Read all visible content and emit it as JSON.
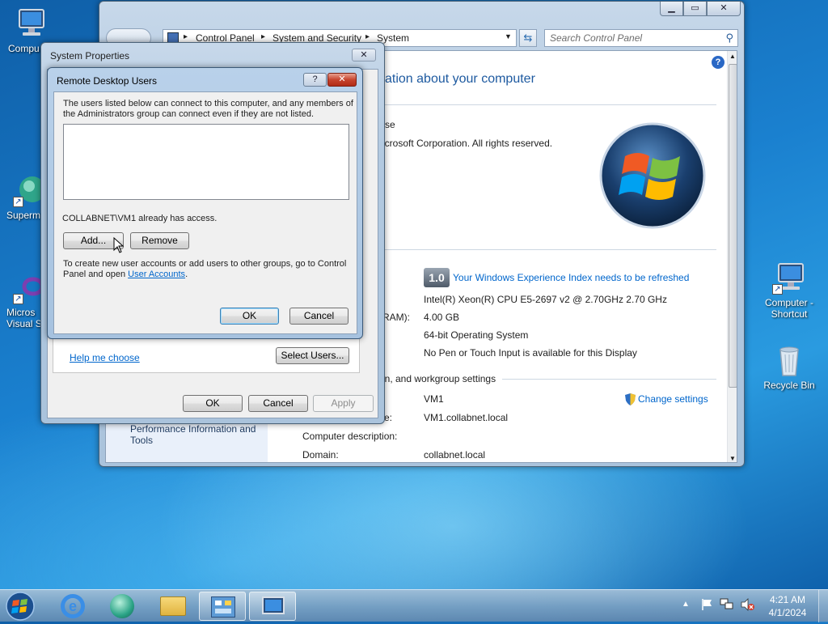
{
  "desktop": {
    "icons": [
      {
        "label": "Compu"
      },
      {
        "label": "Superm"
      },
      {
        "label": "Micros\nVisual St"
      },
      {
        "label": "Computer -\nShortcut"
      },
      {
        "label": "Recycle Bin"
      }
    ]
  },
  "control_panel": {
    "breadcrumb": [
      "Control Panel",
      "System and Security",
      "System"
    ],
    "search_placeholder": "Search Control Panel",
    "heading": "ation about your computer",
    "edition_partial": "se",
    "copyright": "icrosoft Corporation.  All rights reserved.",
    "wei_badge": "1.0",
    "wei_link": "Your Windows Experience Index needs to be refreshed",
    "processor": "Intel(R) Xeon(R) CPU E5-2697 v2 @ 2.70GHz   2.70 GHz",
    "ram_label_partial": "RAM):",
    "ram_value": "4.00 GB",
    "system_type": "64-bit Operating System",
    "pen_touch": "No Pen or Touch Input is available for this Display",
    "section_computer_name": "in, and workgroup settings",
    "computer_name_value": "VM1",
    "change_settings": "Change settings",
    "full_name_label_partial": "e:",
    "full_name_value": "VM1.collabnet.local",
    "description_label": "Computer description:",
    "domain_label": "Domain:",
    "domain_value": "collabnet.local",
    "side_link": "Performance Information and\nTools"
  },
  "system_properties": {
    "title": "System Properties",
    "help_link": "Help me choose",
    "select_users": "Select Users...",
    "ok": "OK",
    "cancel": "Cancel",
    "apply": "Apply"
  },
  "remote_desktop_users": {
    "title": "Remote Desktop Users",
    "description": "The users listed below can connect to this computer, and any members of the Administrators group can connect even if they are not listed.",
    "access_note": "COLLABNET\\VM1 already has access.",
    "add": "Add...",
    "remove": "Remove",
    "footer_text_1": "To create new user accounts or add users to other groups, go to Control Panel and open ",
    "footer_link": "User Accounts",
    "footer_text_2": ".",
    "ok": "OK",
    "cancel": "Cancel"
  },
  "taskbar": {
    "time": "4:21 AM",
    "date": "4/1/2024"
  },
  "colors": {
    "link": "#0066cc",
    "heading": "#1e5aa0",
    "window_frame": "#b2c9e0"
  }
}
